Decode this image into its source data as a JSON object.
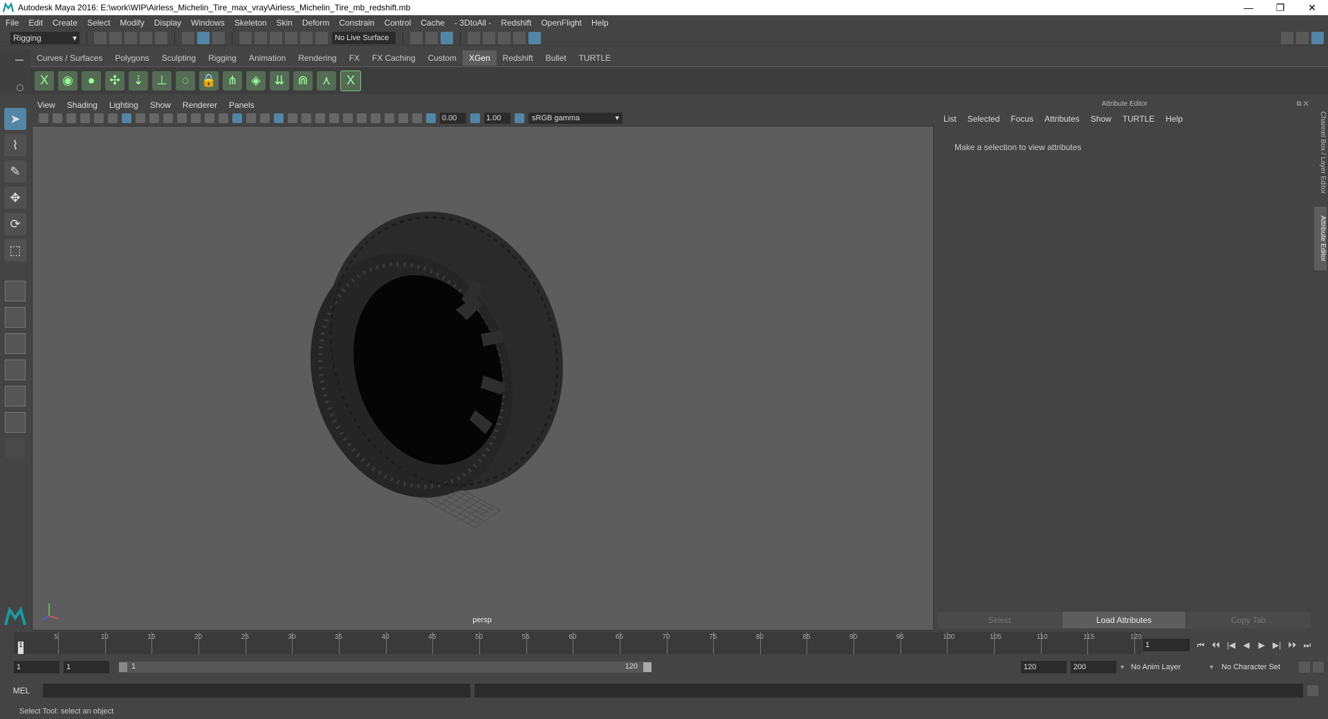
{
  "window": {
    "title": "Autodesk Maya 2016: E:\\work\\WIP\\Airless_Michelin_Tire_max_vray\\Airless_Michelin_Tire_mb_redshift.mb",
    "minimize": "—",
    "restore": "❐",
    "close": "✕"
  },
  "menubar": [
    "File",
    "Edit",
    "Create",
    "Select",
    "Modify",
    "Display",
    "Windows",
    "Skeleton",
    "Skin",
    "Deform",
    "Constrain",
    "Control",
    "Cache",
    "- 3DtoAll -",
    "Redshift",
    "OpenFlight",
    "Help"
  ],
  "statusline": {
    "mode": "Rigging",
    "live_surface": "No Live Surface"
  },
  "shelf": {
    "tabs": [
      "Curves / Surfaces",
      "Polygons",
      "Sculpting",
      "Rigging",
      "Animation",
      "Rendering",
      "FX",
      "FX Caching",
      "Custom",
      "XGen",
      "Redshift",
      "Bullet",
      "TURTLE"
    ],
    "active_tab": "XGen",
    "icon_glyphs": [
      "X",
      "◉",
      "●",
      "✣",
      "⇣",
      "⊥",
      "◌",
      "🔒",
      "⋔",
      "◈",
      "⇊",
      "⋒",
      "⋏",
      "X"
    ]
  },
  "panel": {
    "menu": [
      "View",
      "Shading",
      "Lighting",
      "Show",
      "Renderer",
      "Panels"
    ],
    "exposure": "0.00",
    "gamma": "1.00",
    "color_space": "sRGB gamma",
    "camera": "persp"
  },
  "attribute_editor": {
    "title": "Attribute Editor",
    "menu": [
      "List",
      "Selected",
      "Focus",
      "Attributes",
      "Show",
      "TURTLE",
      "Help"
    ],
    "message": "Make a selection to view attributes",
    "buttons": [
      "Select",
      "Load Attributes",
      "Copy Tab"
    ],
    "side_tabs": [
      "Channel Box / Layer Editor",
      "Attribute Editor"
    ]
  },
  "timeline": {
    "start": 1,
    "end": 120,
    "labels": [
      "5",
      "10",
      "15",
      "20",
      "25",
      "30",
      "35",
      "40",
      "45",
      "50",
      "55",
      "60",
      "65",
      "70",
      "75",
      "80",
      "85",
      "90",
      "95",
      "100",
      "105",
      "110",
      "115",
      "120"
    ],
    "current_frame_marker": "1",
    "current_frame": "1",
    "playback_glyphs": [
      "⏮",
      "⏴⏴",
      "|◀",
      "◀",
      "▶",
      "▶|",
      "⏵⏵",
      "⏭"
    ]
  },
  "range": {
    "start_time": "1",
    "playback_start": "1",
    "slider_start": "1",
    "slider_end": "120",
    "playback_end": "120",
    "end_time": "200",
    "anim_layer": "No Anim Layer",
    "character_set": "No Character Set"
  },
  "command": {
    "label": "MEL"
  },
  "help_line": "Select Tool: select an object",
  "colors": {
    "accent": "#5285a6",
    "xgen_green": "#7ec97e",
    "viewport_bg": "#5d5d5d"
  }
}
